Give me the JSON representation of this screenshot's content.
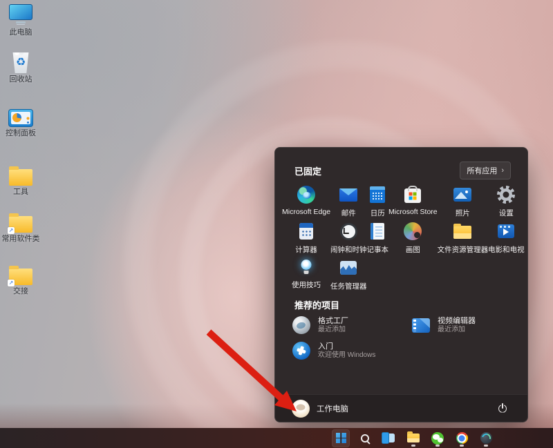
{
  "desktop": {
    "icons": [
      {
        "label": "此电脑",
        "icon": "this-pc-icon"
      },
      {
        "label": "回收站",
        "icon": "recycle-bin-icon"
      },
      {
        "label": "控制面板",
        "icon": "control-panel-icon"
      },
      {
        "label": "工具",
        "icon": "folder-icon"
      },
      {
        "label": "常用软件类",
        "icon": "folder-shortcut-icon"
      },
      {
        "label": "交接",
        "icon": "folder-shortcut-icon"
      }
    ]
  },
  "start_menu": {
    "pinned_header": "已固定",
    "all_apps_label": "所有应用",
    "all_apps_chevron": "›",
    "pinned": [
      {
        "label": "Microsoft Edge",
        "icon": "edge-icon"
      },
      {
        "label": "邮件",
        "icon": "mail-icon"
      },
      {
        "label": "日历",
        "icon": "calendar-icon"
      },
      {
        "label": "Microsoft Store",
        "icon": "store-icon"
      },
      {
        "label": "照片",
        "icon": "photos-icon"
      },
      {
        "label": "设置",
        "icon": "settings-gear-icon"
      },
      {
        "label": "计算器",
        "icon": "calculator-icon"
      },
      {
        "label": "闹钟和时钟",
        "icon": "clock-icon"
      },
      {
        "label": "记事本",
        "icon": "notepad-icon"
      },
      {
        "label": "画图",
        "icon": "paint-icon"
      },
      {
        "label": "文件资源管理器",
        "icon": "file-explorer-icon"
      },
      {
        "label": "电影和电视",
        "icon": "movies-tv-icon"
      },
      {
        "label": "使用技巧",
        "icon": "tips-icon"
      },
      {
        "label": "任务管理器",
        "icon": "task-manager-icon"
      }
    ],
    "recommended_header": "推荐的项目",
    "recommended": [
      {
        "title": "格式工厂",
        "subtitle": "最近添加",
        "icon": "format-factory-icon"
      },
      {
        "title": "视频编辑器",
        "subtitle": "最近添加",
        "icon": "video-editor-icon"
      },
      {
        "title": "入门",
        "subtitle": "欢迎使用 Windows",
        "icon": "get-started-icon"
      }
    ],
    "user": {
      "name": "工作电脑",
      "icon": "user-avatar"
    },
    "power": {
      "icon": "power-icon"
    }
  },
  "taskbar": {
    "items": [
      {
        "icon": "start-icon",
        "active": true,
        "running": false
      },
      {
        "icon": "search-icon",
        "active": false,
        "running": false
      },
      {
        "icon": "task-view-icon",
        "active": false,
        "running": false
      },
      {
        "icon": "file-explorer-icon",
        "active": false,
        "running": true
      },
      {
        "icon": "wechat-icon",
        "active": false,
        "running": true
      },
      {
        "icon": "chrome-icon",
        "active": false,
        "running": true
      },
      {
        "icon": "format-factory-icon",
        "active": false,
        "running": true
      }
    ]
  },
  "annotation": {
    "type": "arrow",
    "color": "#dc1f12",
    "points_to": "user-account-button"
  }
}
